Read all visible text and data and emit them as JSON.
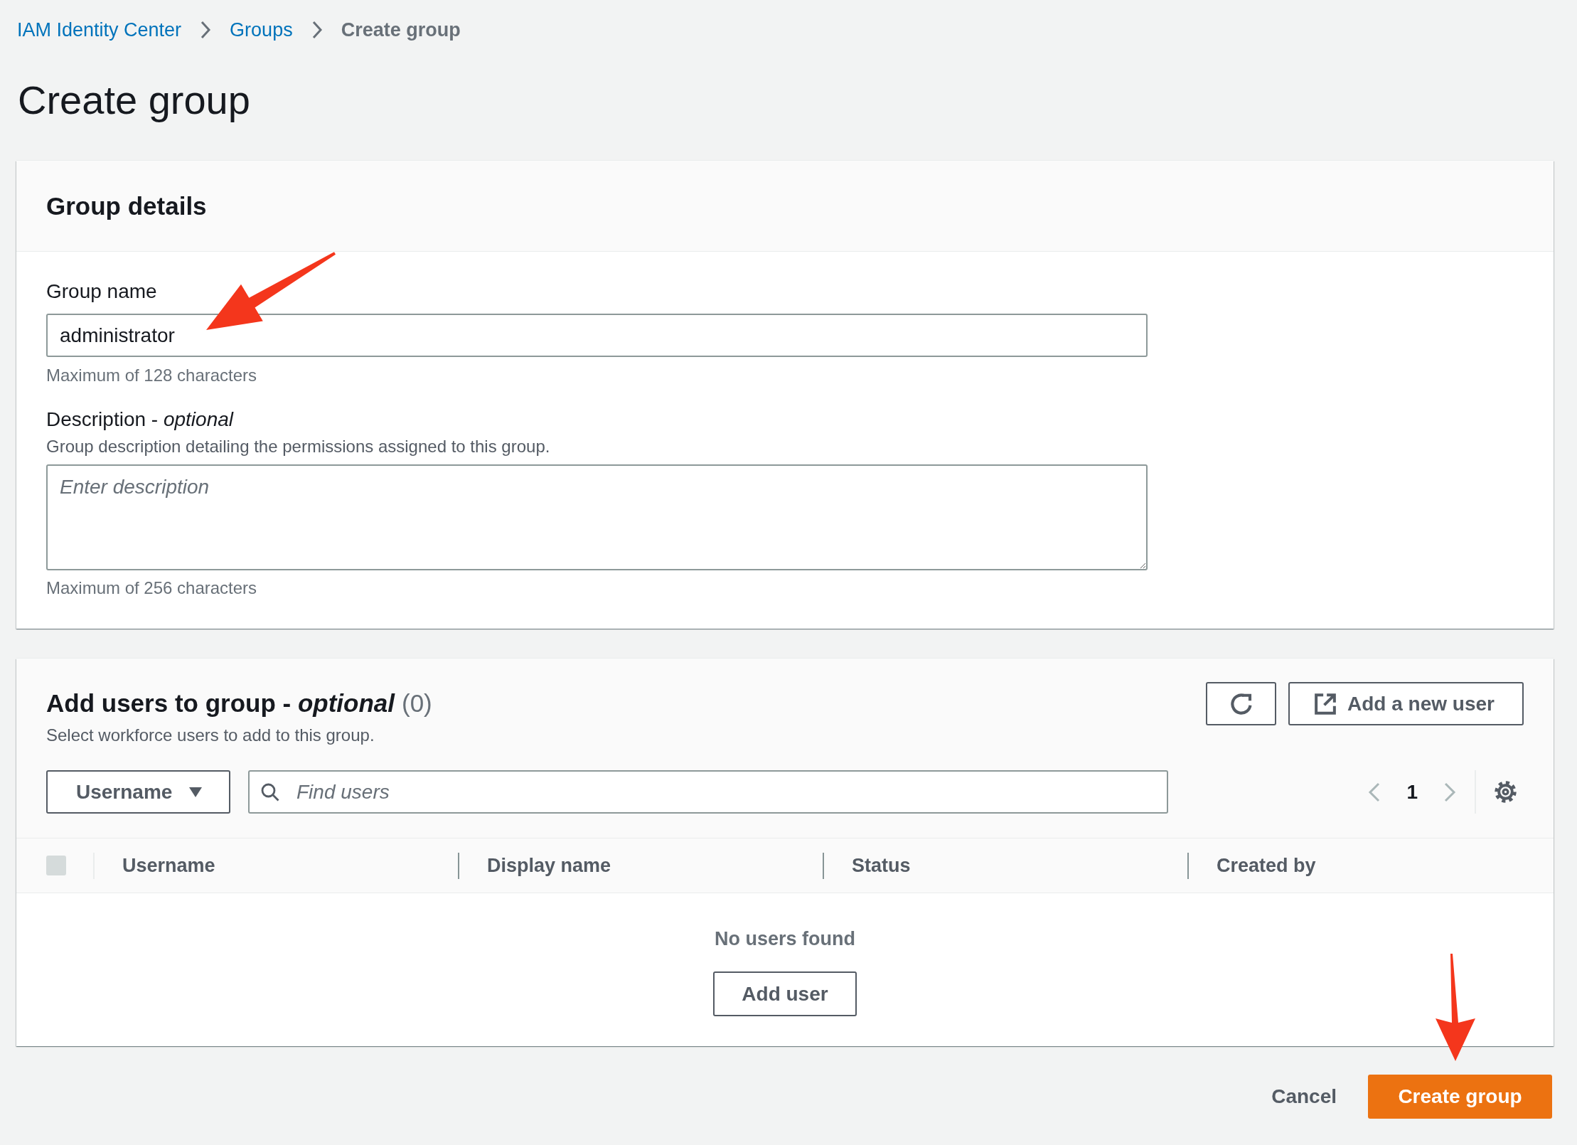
{
  "breadcrumbs": [
    {
      "label": "IAM Identity Center",
      "kind": "link"
    },
    {
      "label": "Groups",
      "kind": "link"
    },
    {
      "label": "Create group",
      "kind": "current"
    }
  ],
  "page_title": "Create group",
  "group_details": {
    "title": "Group details",
    "group_name": {
      "label": "Group name",
      "value": "administrator",
      "constraint": "Maximum of 128 characters"
    },
    "description": {
      "label": "Description - *optional*",
      "help": "Group description detailing the permissions assigned to this group.",
      "placeholder": "Enter description",
      "constraint": "Maximum of 256 characters"
    }
  },
  "add_users": {
    "title": "Add users to group - *optional*",
    "count": "(0)",
    "subtitle": "Select workforce users to add to this group.",
    "actions": [
      {
        "kind": "refresh"
      },
      {
        "kind": "external",
        "label": "Add a new user"
      }
    ],
    "filter_property": "Username",
    "search": {
      "placeholder": "Find users"
    },
    "pagination": {
      "previous_disabled": true,
      "pages": [
        {
          "label": "1",
          "selected": true
        }
      ],
      "next_disabled": true
    },
    "table": {
      "select_all": {
        "checked": false,
        "disabled": true
      },
      "columns": [
        "Username",
        "Display name",
        "Status",
        "Created by"
      ],
      "empty_message": "No users found",
      "empty_action": "Add user"
    }
  },
  "footer": {
    "buttons": [
      {
        "label": "Cancel",
        "kind": "link"
      },
      {
        "label": "Create group",
        "kind": "primary"
      }
    ]
  }
}
